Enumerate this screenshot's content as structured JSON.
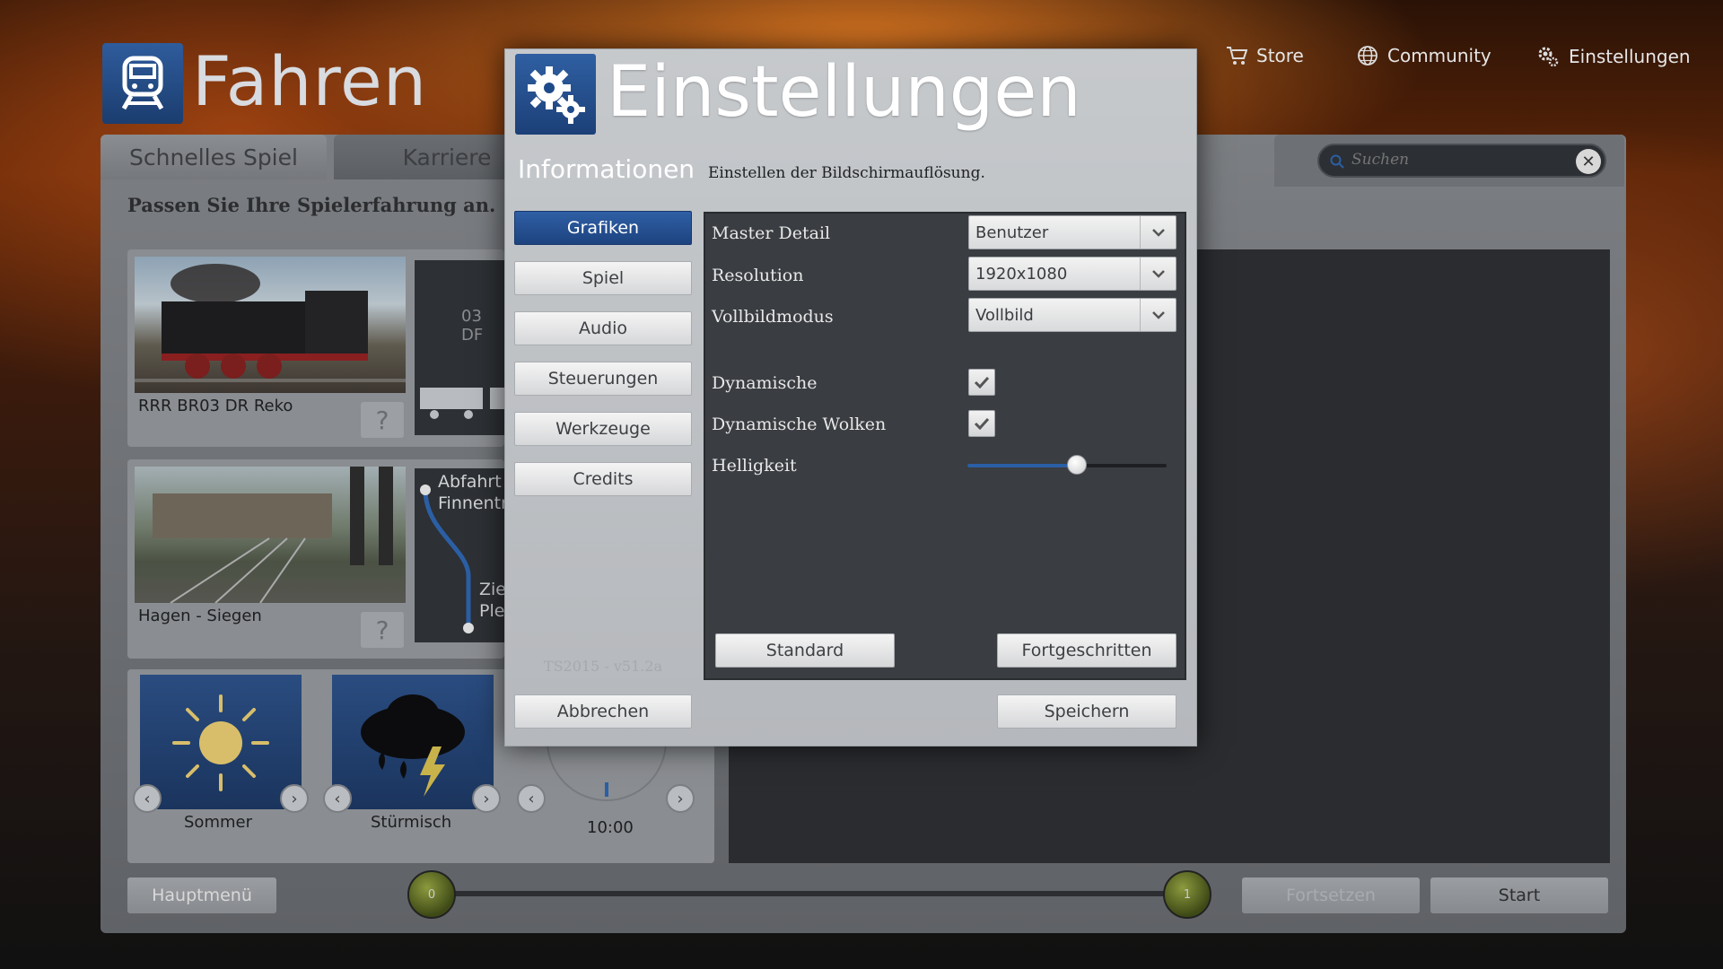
{
  "app": {
    "page_title": "Fahren",
    "nav": {
      "store": "Store",
      "community": "Community",
      "settings": "Einstellungen"
    },
    "tabs": [
      "Schnelles Spiel",
      "Karriere"
    ],
    "subtitle": "Passen Sie Ihre Spielerfahrung an.",
    "search": {
      "placeholder": "Suchen"
    },
    "loco": {
      "name": "RRR BR03 DR Reko",
      "code_fragment": "03 DF"
    },
    "route": {
      "name": "Hagen - Siegen",
      "start_fragment_1": "Abfahrt",
      "start_fragment_2": "Finnentr",
      "end_fragment_1": "Zie",
      "end_fragment_2": "Ple"
    },
    "weather": [
      {
        "label": "Sommer",
        "icon": "sun-icon"
      },
      {
        "label": "Stürmisch",
        "icon": "storm-icon"
      }
    ],
    "time": "10:00",
    "bottom": {
      "main_menu": "Hauptmenü",
      "continue": "Fortsetzen",
      "start": "Start",
      "timeline_start": "0",
      "timeline_end": "1"
    }
  },
  "dialog": {
    "title": "Einstellungen",
    "section": "Informationen",
    "description": "Einstellen der Bildschirmauflösung.",
    "categories": [
      {
        "label": "Grafiken",
        "active": true
      },
      {
        "label": "Spiel",
        "active": false
      },
      {
        "label": "Audio",
        "active": false
      },
      {
        "label": "Steuerungen",
        "active": false
      },
      {
        "label": "Werkzeuge",
        "active": false
      },
      {
        "label": "Credits",
        "active": false
      }
    ],
    "version": "TS2015 - v51.2a",
    "settings": {
      "master_detail": {
        "label": "Master Detail",
        "value": "Benutzer"
      },
      "resolution": {
        "label": "Resolution",
        "value": "1920x1080"
      },
      "fullscreen": {
        "label": "Vollbildmodus",
        "value": "Vollbild"
      },
      "dynamic": {
        "label": "Dynamische",
        "checked": true
      },
      "dynamic_clouds": {
        "label": "Dynamische Wolken",
        "checked": true
      },
      "brightness": {
        "label": "Helligkeit",
        "value": 0.55
      }
    },
    "buttons": {
      "default": "Standard",
      "advanced": "Fortgeschritten",
      "cancel": "Abbrechen",
      "save": "Speichern"
    },
    "colors": {
      "accent": "#1f4a8a",
      "pane": "#3a3d41"
    }
  }
}
